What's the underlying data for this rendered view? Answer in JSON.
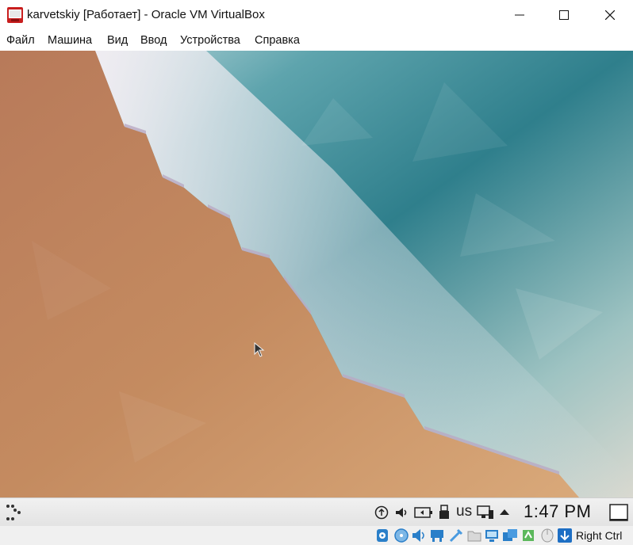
{
  "window": {
    "title": "karvetskiy [Работает] - Oracle VM VirtualBox"
  },
  "menu": [
    "Файл",
    "Машина",
    "Вид",
    "Ввод",
    "Устройства",
    "Справка"
  ],
  "guest_panel": {
    "keyboard_layout": "us",
    "clock": "1:47 PM"
  },
  "status_bar": {
    "host_key": "Right Ctrl"
  },
  "colors": {
    "sand": "#c89466",
    "foam": "#ece6ec",
    "sea": "#3f8f9a",
    "panel": "#e9e9e9",
    "vbox_blue": "#1e6fc4"
  }
}
